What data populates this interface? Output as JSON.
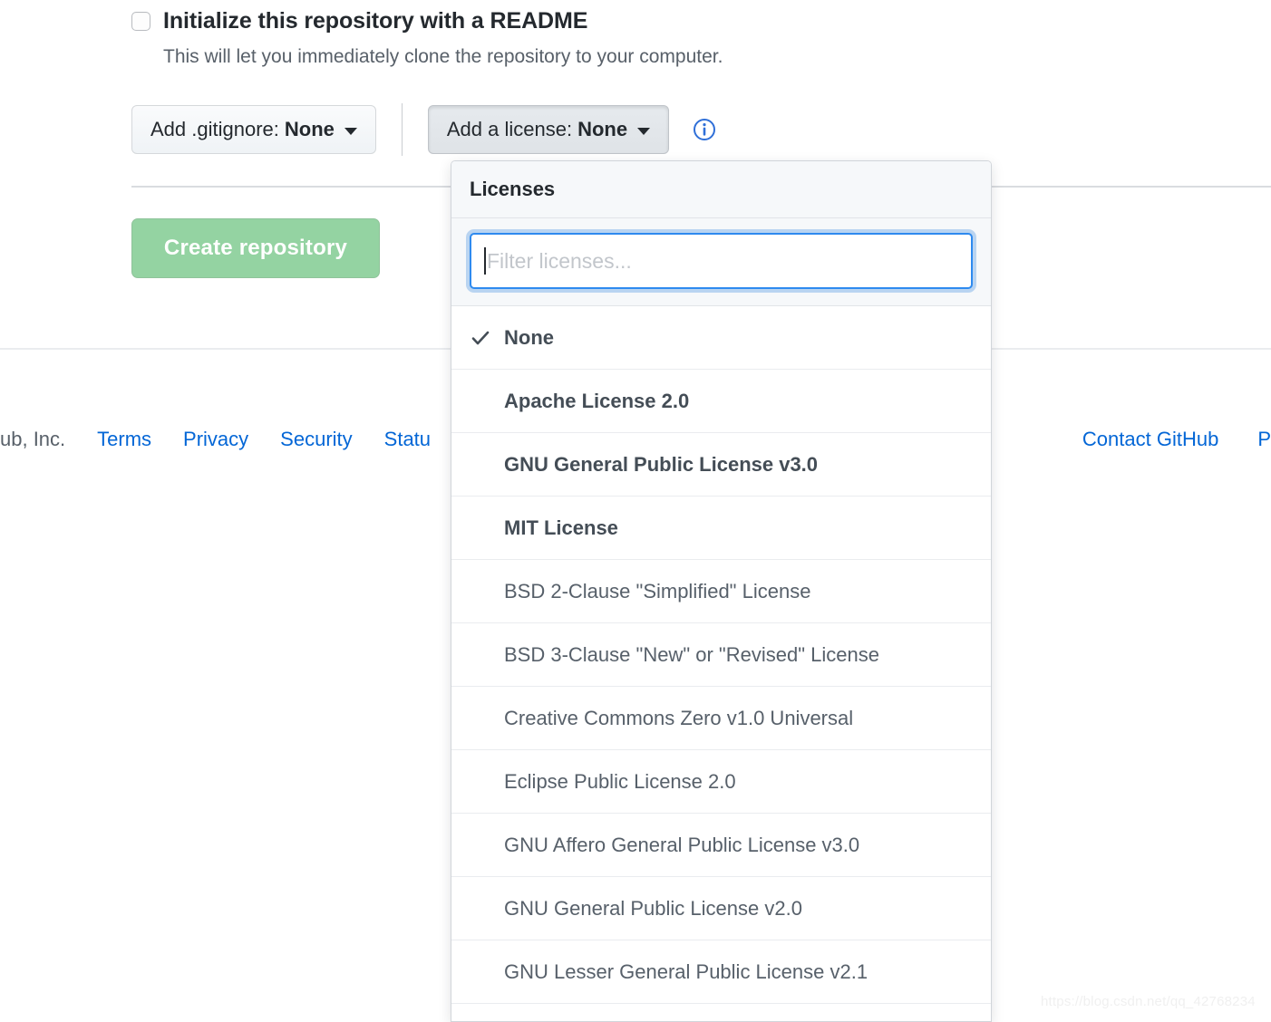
{
  "readme": {
    "label": "Initialize this repository with a README",
    "description": "This will let you immediately clone the repository to your computer.",
    "checked": false
  },
  "options": {
    "gitignore": {
      "prefix": "Add .gitignore:",
      "value": "None"
    },
    "license": {
      "prefix": "Add a license:",
      "value": "None"
    },
    "info_icon": "info-icon"
  },
  "create": {
    "label": "Create repository",
    "color": "#94d3a2"
  },
  "footer": {
    "copyright": "ub, Inc.",
    "left_links": [
      "Terms",
      "Privacy",
      "Security",
      "Statu"
    ],
    "right_links": [
      "Contact GitHub",
      "P"
    ],
    "link_color": "#0366d6"
  },
  "dropdown": {
    "title": "Licenses",
    "filter": {
      "value": "",
      "placeholder": "Filter licenses..."
    },
    "items": [
      {
        "label": "None",
        "selected": true,
        "featured": true
      },
      {
        "label": "Apache License 2.0",
        "selected": false,
        "featured": true
      },
      {
        "label": "GNU General Public License v3.0",
        "selected": false,
        "featured": true
      },
      {
        "label": "MIT License",
        "selected": false,
        "featured": true
      },
      {
        "label": "BSD 2-Clause \"Simplified\" License",
        "selected": false,
        "featured": false
      },
      {
        "label": "BSD 3-Clause \"New\" or \"Revised\" License",
        "selected": false,
        "featured": false
      },
      {
        "label": "Creative Commons Zero v1.0 Universal",
        "selected": false,
        "featured": false
      },
      {
        "label": "Eclipse Public License 2.0",
        "selected": false,
        "featured": false
      },
      {
        "label": "GNU Affero General Public License v3.0",
        "selected": false,
        "featured": false
      },
      {
        "label": "GNU General Public License v2.0",
        "selected": false,
        "featured": false
      },
      {
        "label": "GNU Lesser General Public License v2.1",
        "selected": false,
        "featured": false
      }
    ]
  },
  "watermark": "https://blog.csdn.net/qq_42768234"
}
